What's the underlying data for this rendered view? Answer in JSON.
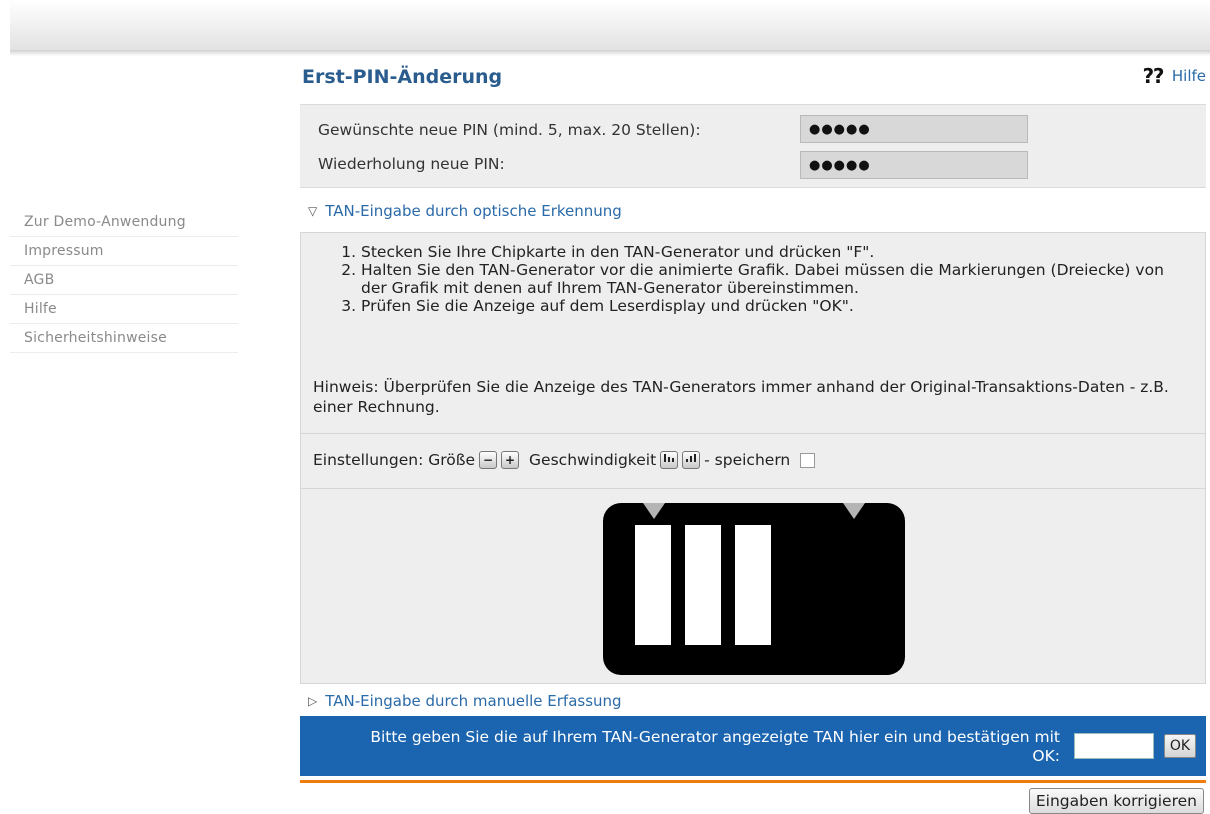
{
  "sidebar": {
    "items": [
      {
        "label": "Zur Demo-Anwendung"
      },
      {
        "label": "Impressum"
      },
      {
        "label": "AGB"
      },
      {
        "label": "Hilfe"
      },
      {
        "label": "Sicherheitshinweise"
      }
    ]
  },
  "header": {
    "title": "Erst-PIN-Änderung",
    "help_label": "Hilfe",
    "help_icon": "help-icon"
  },
  "pin_form": {
    "new_pin_label": "Gewünschte neue PIN (mind. 5, max. 20 Stellen):",
    "new_pin_value": "●●●●●",
    "repeat_pin_label": "Wiederholung neue PIN:",
    "repeat_pin_value": "●●●●●"
  },
  "optical": {
    "heading": "TAN-Eingabe durch optische Erkennung",
    "expanded": true,
    "steps": [
      "Stecken Sie Ihre Chipkarte in den TAN-Generator und drücken \"F\".",
      "Halten Sie den TAN-Generator vor die animierte Grafik. Dabei müssen die Markierungen (Dreiecke) von der Grafik mit denen auf Ihrem TAN-Generator übereinstimmen.",
      "Prüfen Sie die Anzeige auf dem Leserdisplay und drücken \"OK\"."
    ],
    "note": "Hinweis: Überprüfen Sie die Anzeige des TAN-Generators immer anhand der Original-Transaktions-Daten - z.B. einer Rechnung.",
    "settings": {
      "prefix": "Einstellungen: Größe",
      "minus": "−",
      "plus": "+",
      "speed_label": "Geschwindigkeit",
      "speed_slow_icon": "speed-slower-icon",
      "speed_fast_icon": "speed-faster-icon",
      "save_label": "- speichern",
      "save_checked": false
    }
  },
  "manual": {
    "heading": "TAN-Eingabe durch manuelle Erfassung",
    "expanded": false
  },
  "tan_entry": {
    "prompt": "Bitte geben Sie die auf Ihrem TAN-Generator angezeigte TAN hier ein und bestätigen mit OK:",
    "value": "",
    "ok_label": "OK"
  },
  "correct_button": "Eingaben korrigieren",
  "colors": {
    "title": "#2a5c8e",
    "link": "#2a6aa8",
    "tan_bar": "#1a64b0",
    "accent_line": "#f07c10"
  }
}
